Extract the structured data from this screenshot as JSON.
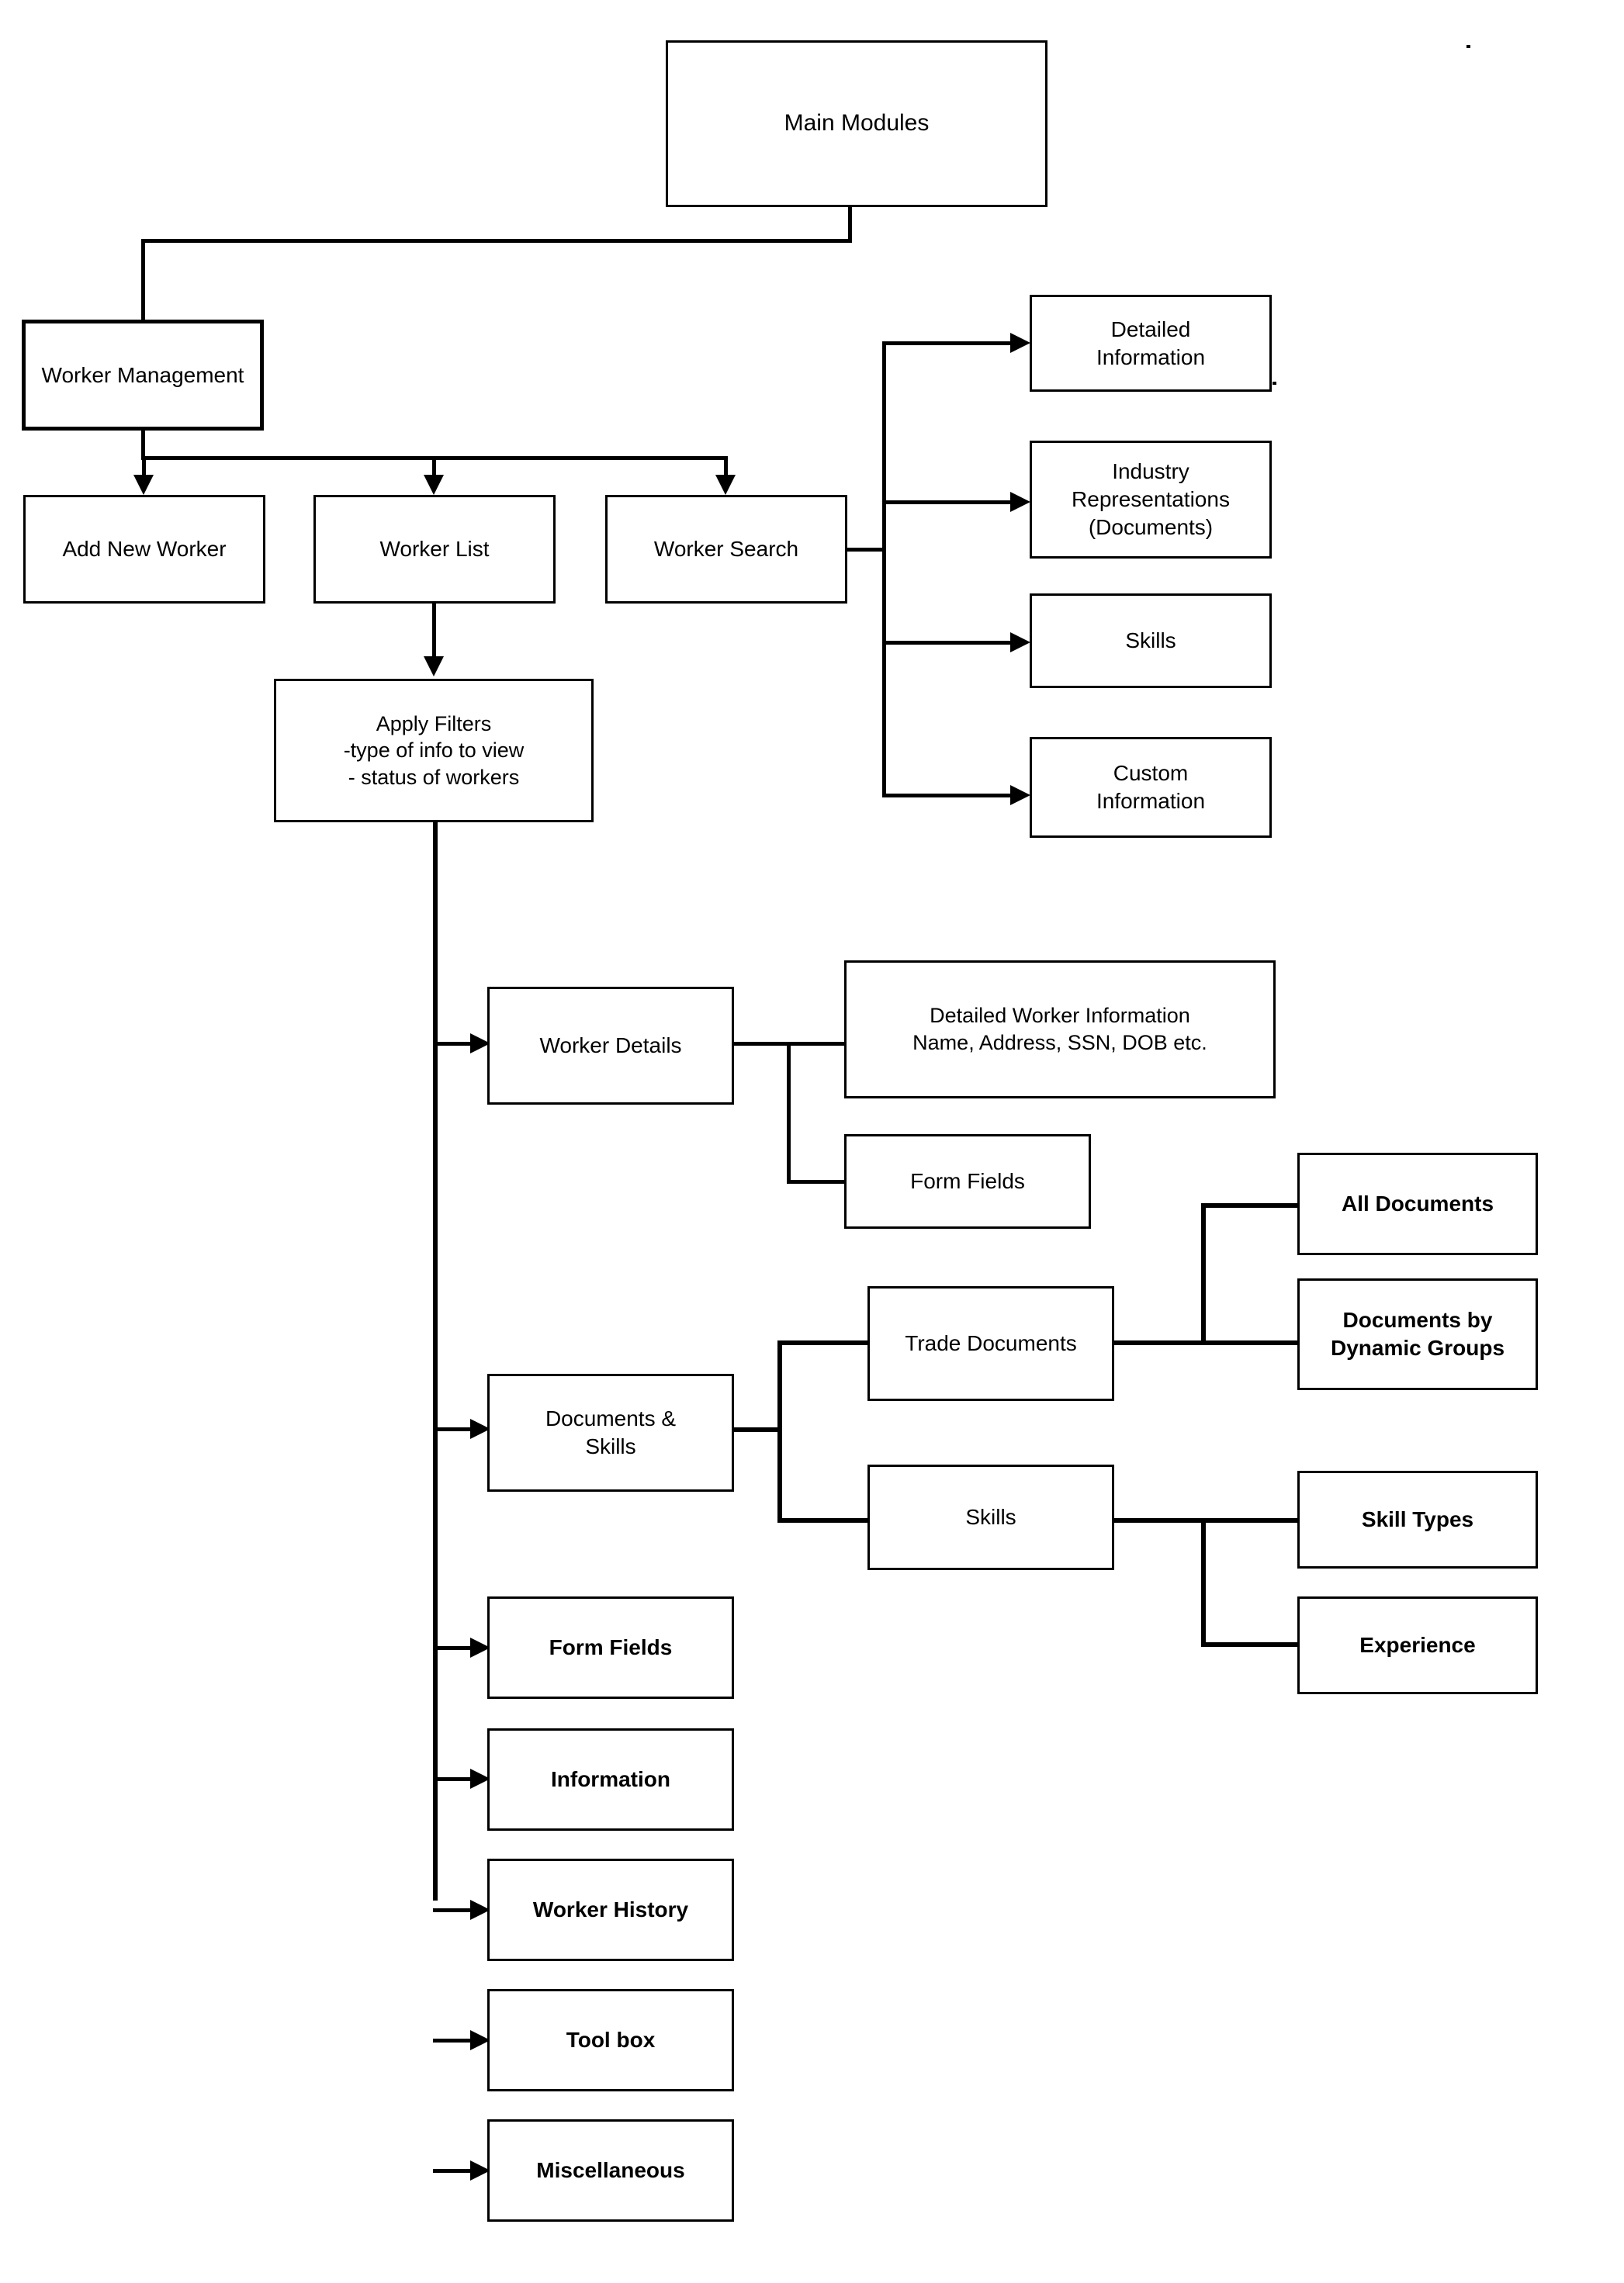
{
  "diagram": {
    "title": "Main Modules site map",
    "type": "flowchart",
    "orientation": "top-down-then-left-right",
    "line_color": "#000000",
    "background_color": "#ffffff",
    "nodes": {
      "main_modules": "Main Modules",
      "worker_management": "Worker Management",
      "add_new_worker": "Add New Worker",
      "worker_list": "Worker List",
      "worker_search": "Worker Search",
      "detailed_information": "Detailed\nInformation",
      "industry_representations": "Industry\nRepresentations\n(Documents)",
      "skills_search": "Skills",
      "custom_information": "Custom\nInformation",
      "apply_filters": "Apply Filters\n-type of info to view\n- status of workers",
      "worker_details": "Worker Details",
      "detailed_worker_information": "Detailed Worker Information\nName, Address, SSN, DOB etc.",
      "form_fields_details": "Form Fields",
      "documents_and_skills": "Documents &\nSkills",
      "trade_documents": "Trade Documents",
      "all_documents": "All Documents",
      "documents_by_dynamic_groups": "Documents by\nDynamic Groups",
      "skills_branch": "Skills",
      "skill_types": "Skill Types",
      "experience": "Experience",
      "form_fields": "Form Fields",
      "information": "Information",
      "worker_history": "Worker History",
      "tool_box": "Tool box",
      "miscellaneous": "Miscellaneous"
    },
    "edges": [
      {
        "from": "main_modules",
        "to": "worker_management"
      },
      {
        "from": "worker_management",
        "to": "add_new_worker"
      },
      {
        "from": "worker_management",
        "to": "worker_list"
      },
      {
        "from": "worker_management",
        "to": "worker_search"
      },
      {
        "from": "worker_search",
        "to": "detailed_information"
      },
      {
        "from": "worker_search",
        "to": "industry_representations"
      },
      {
        "from": "worker_search",
        "to": "skills_search"
      },
      {
        "from": "worker_search",
        "to": "custom_information"
      },
      {
        "from": "worker_list",
        "to": "apply_filters"
      },
      {
        "from": "apply_filters",
        "to": "worker_details"
      },
      {
        "from": "apply_filters",
        "to": "documents_and_skills"
      },
      {
        "from": "apply_filters",
        "to": "form_fields"
      },
      {
        "from": "apply_filters",
        "to": "information"
      },
      {
        "from": "apply_filters",
        "to": "worker_history"
      },
      {
        "from": "apply_filters",
        "to": "tool_box"
      },
      {
        "from": "apply_filters",
        "to": "miscellaneous"
      },
      {
        "from": "worker_details",
        "to": "detailed_worker_information"
      },
      {
        "from": "worker_details",
        "to": "form_fields_details"
      },
      {
        "from": "documents_and_skills",
        "to": "trade_documents"
      },
      {
        "from": "documents_and_skills",
        "to": "skills_branch"
      },
      {
        "from": "trade_documents",
        "to": "all_documents"
      },
      {
        "from": "trade_documents",
        "to": "documents_by_dynamic_groups"
      },
      {
        "from": "skills_branch",
        "to": "skill_types"
      },
      {
        "from": "skills_branch",
        "to": "experience"
      }
    ]
  }
}
